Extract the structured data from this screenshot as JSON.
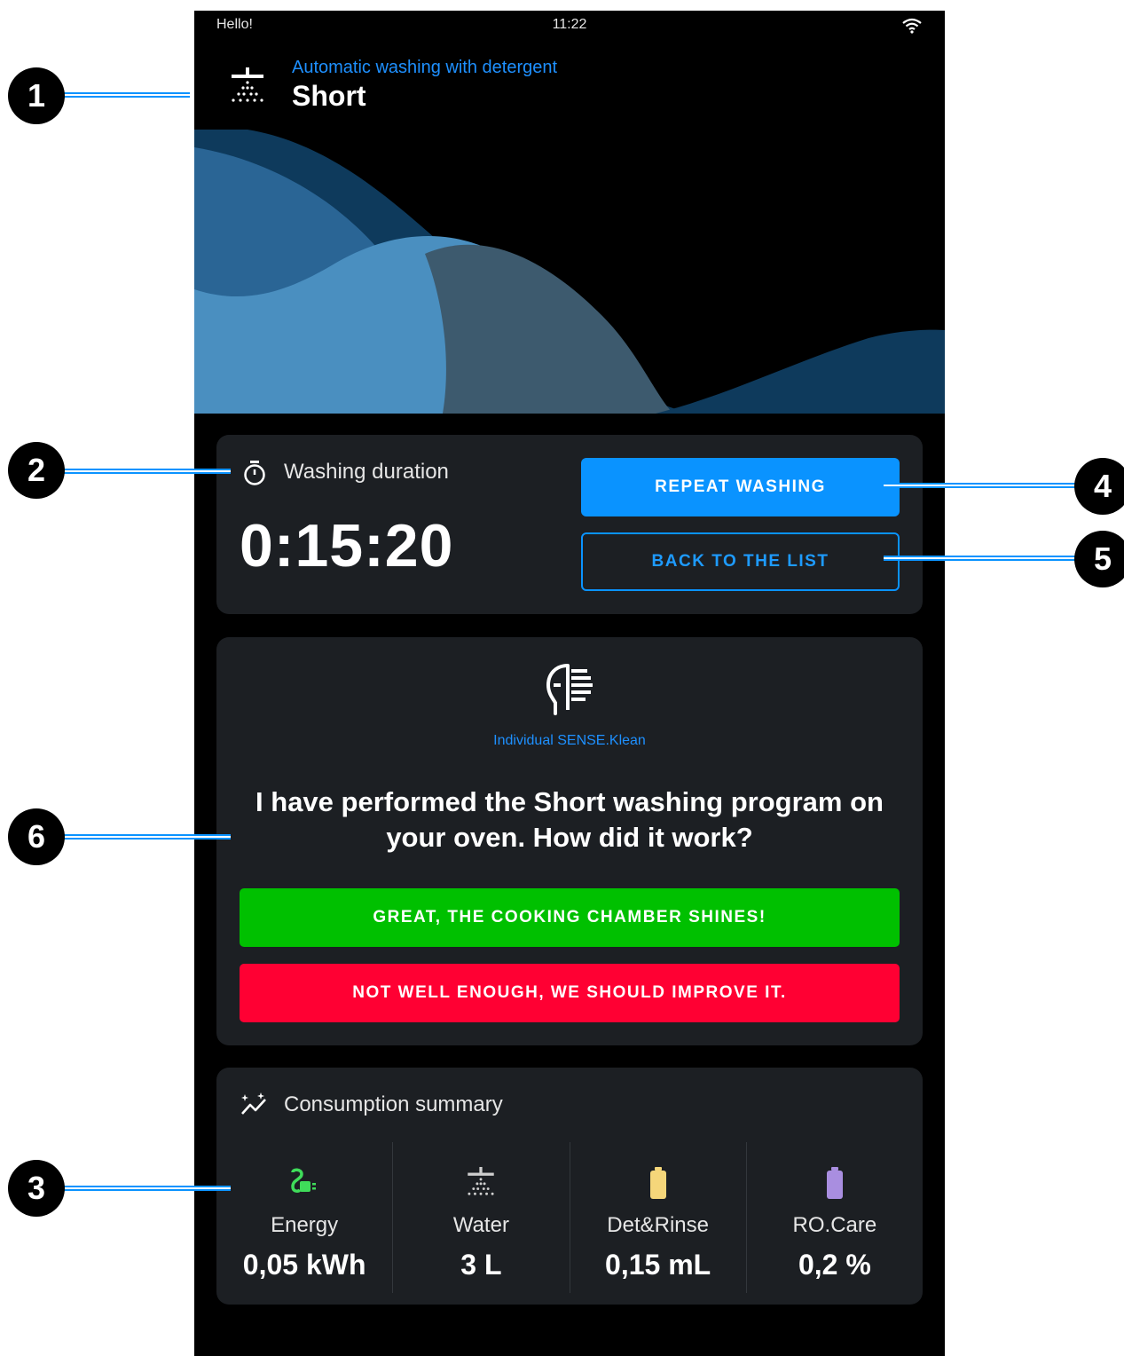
{
  "status_bar": {
    "greeting": "Hello!",
    "time": "11:22",
    "wifi_icon": "wifi-icon"
  },
  "header": {
    "subtitle": "Automatic washing with detergent",
    "title": "Short",
    "icon": "shower-icon"
  },
  "duration_card": {
    "label": "Washing duration",
    "value": "0:15:20",
    "repeat_label": "REPEAT WASHING",
    "back_label": "BACK TO THE LIST"
  },
  "feedback_card": {
    "sense_label": "Individual SENSE.Klean",
    "question": "I have performed the Short washing program on your oven. How did it work?",
    "great_label": "GREAT, THE COOKING CHAMBER SHINES!",
    "bad_label": "NOT WELL ENOUGH, WE SHOULD IMPROVE IT."
  },
  "consumption": {
    "title": "Consumption summary",
    "items": [
      {
        "name": "Energy",
        "value": "0,05 kWh",
        "icon": "energy-plug-icon",
        "color": "#3fdc5a"
      },
      {
        "name": "Water",
        "value": "3 L",
        "icon": "water-shower-icon",
        "color": "#cfcfcf"
      },
      {
        "name": "Det&Rinse",
        "value": "0,15 mL",
        "icon": "detergent-battery-icon",
        "color": "#f5d67a"
      },
      {
        "name": "RO.Care",
        "value": "0,2 %",
        "icon": "rocare-battery-icon",
        "color": "#a98ee0"
      }
    ]
  },
  "callouts": [
    "1",
    "2",
    "3",
    "4",
    "5",
    "6"
  ],
  "colors": {
    "accent": "#0a93ff",
    "great": "#00c000",
    "bad": "#ff0033",
    "card": "#1c1f23"
  }
}
